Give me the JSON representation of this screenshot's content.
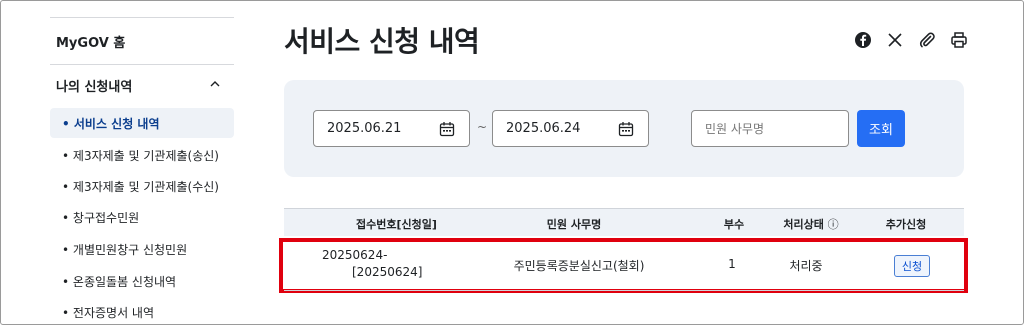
{
  "sidebar": {
    "home": "MyGOV 홈",
    "section": "나의 신청내역",
    "items": [
      {
        "label": "서비스 신청 내역",
        "active": true
      },
      {
        "label": "제3자제출 및 기관제출(송신)"
      },
      {
        "label": "제3자제출 및 기관제출(수신)"
      },
      {
        "label": "창구접수민원"
      },
      {
        "label": "개별민원창구 신청민원"
      },
      {
        "label": "온종일돌봄 신청내역"
      },
      {
        "label": "전자증명서 내역"
      }
    ]
  },
  "main": {
    "title": "서비스 신청 내역",
    "share_icons": [
      "facebook-icon",
      "x-icon",
      "attach-icon",
      "print-icon"
    ],
    "search": {
      "start_date": "2025.06.21",
      "end_date": "2025.06.24",
      "separator": "~",
      "name_placeholder": "민원 사무명",
      "search_label": "조회"
    },
    "table": {
      "headers": [
        "접수번호[신청일]",
        "민원 사무명",
        "부수",
        "처리상태",
        "추가신청"
      ],
      "status_info_icon": "ⓘ",
      "rows": [
        {
          "receipt_line1": "20250624-",
          "receipt_line2": "[20250624]",
          "name": "주민등록증분실신고(철회)",
          "count": "1",
          "status": "처리중",
          "action": "신청"
        }
      ]
    }
  },
  "colors": {
    "accent": "#256ef4",
    "highlight": "#e0000e",
    "panel": "#eef2f7",
    "active_text": "#0b3e8e"
  }
}
